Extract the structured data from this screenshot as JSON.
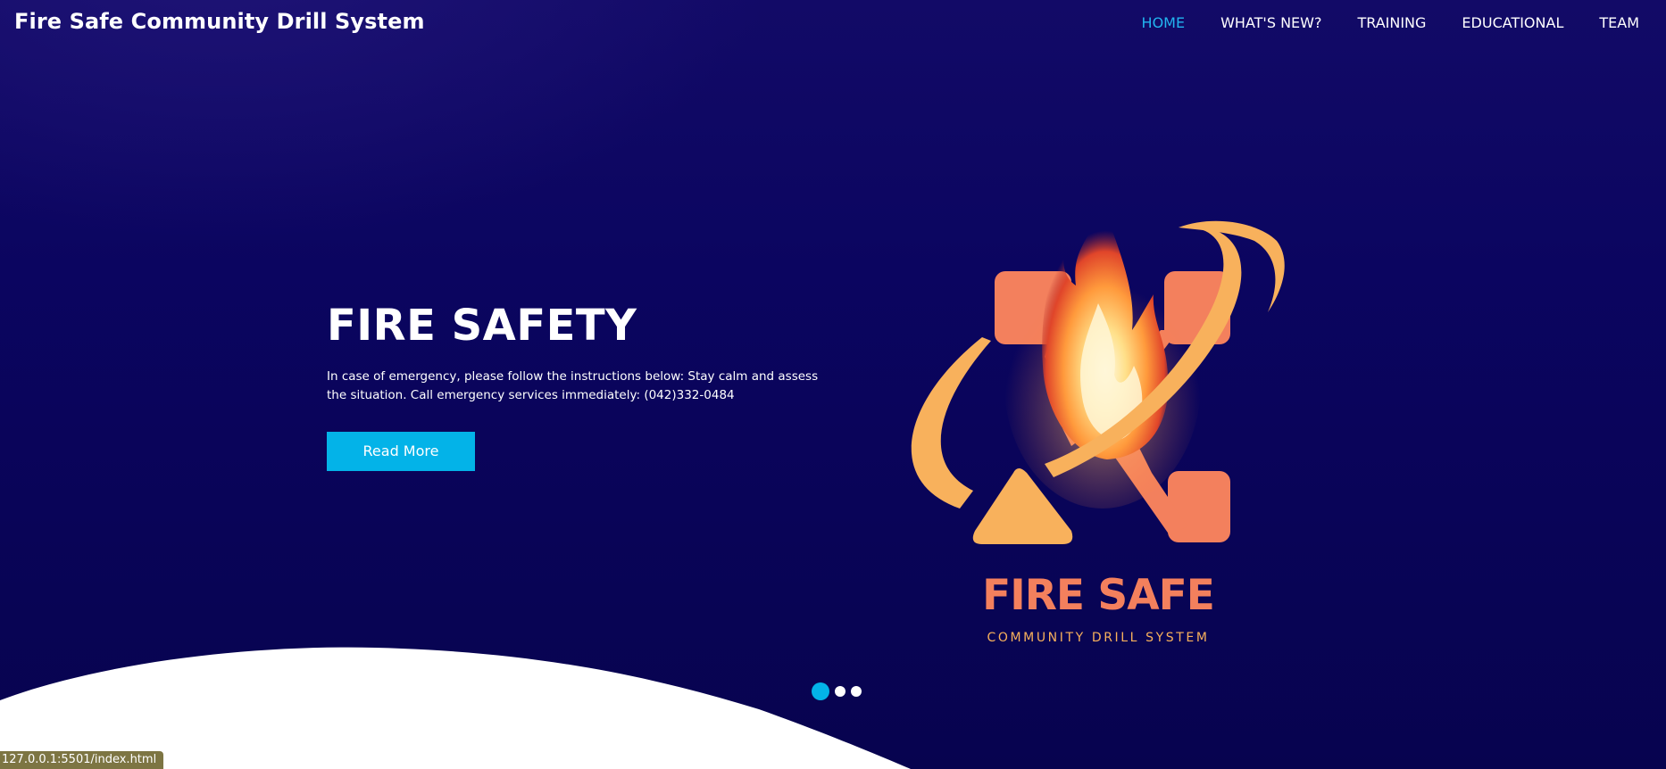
{
  "header": {
    "brand": "Fire Safe Community Drill System"
  },
  "nav": {
    "items": [
      {
        "label": "HOME",
        "active": true
      },
      {
        "label": "WHAT'S NEW?",
        "active": false
      },
      {
        "label": "TRAINING",
        "active": false
      },
      {
        "label": "EDUCATIONAL",
        "active": false
      },
      {
        "label": "TEAM",
        "active": false
      }
    ]
  },
  "hero": {
    "title": "FIRE SAFETY",
    "text": "In case of emergency, please follow the instructions below: Stay calm and assess the situation. Call emergency services immediately: (042)332-0484",
    "button_label": "Read More"
  },
  "logo": {
    "title": "FIRE SAFE",
    "subtitle": "COMMUNITY DRILL SYSTEM",
    "icon": "flame-x-logo-icon"
  },
  "slider": {
    "count": 3,
    "active_index": 0
  },
  "status_bar": {
    "url": "127.0.0.1:5501/index.html"
  },
  "colors": {
    "accent": "#03b3e8",
    "background": "#0b0560",
    "logo_orange": "#f3805d",
    "logo_yellow": "#f8b15c"
  }
}
